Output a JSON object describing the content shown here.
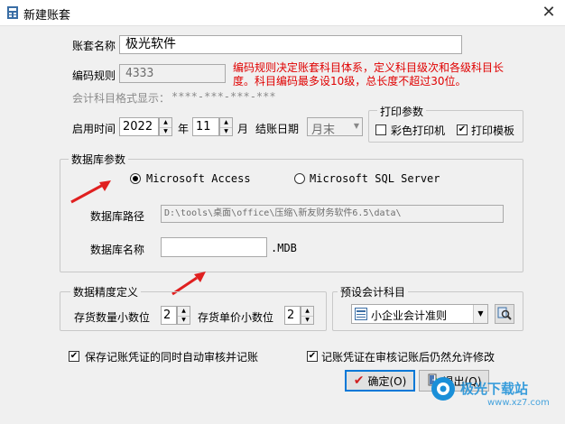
{
  "window": {
    "title": "新建账套",
    "close_glyph": "✕"
  },
  "account_name": {
    "label": "账套名称",
    "value": "极光软件"
  },
  "coding_rule": {
    "label": "编码规则",
    "value": "4333",
    "note": "编码规则决定账套科目体系，定义科目级次和各级科目长度。科目编码最多设10级，总长度不超过30位。",
    "format_label": "会计科目格式显示：",
    "format_value": "****-***-***-***"
  },
  "start_time": {
    "label": "启用时间",
    "year": "2022",
    "year_unit": "年",
    "month": "11",
    "month_unit": "月",
    "closing_label": "结账日期",
    "closing_value": "月末"
  },
  "print_params": {
    "title": "打印参数",
    "color_printer": {
      "label": "彩色打印机",
      "checked": false
    },
    "print_template": {
      "label": "打印模板",
      "checked": true
    }
  },
  "database": {
    "title": "数据库参数",
    "access_label": "Microsoft Access",
    "sql_label": "Microsoft SQL Server",
    "selected": "access",
    "path_label": "数据库路径",
    "path_value": "D:\\tools\\桌面\\office\\压缩\\新友财务软件6.5\\data\\",
    "name_label": "数据库名称",
    "name_value": "",
    "ext": ".MDB"
  },
  "precision": {
    "title": "数据精度定义",
    "qty_label": "存货数量小数位",
    "qty_value": "2",
    "price_label": "存货单价小数位",
    "price_value": "2"
  },
  "preset_subjects": {
    "title": "预设会计科目",
    "value": "小企业会计准则"
  },
  "options": {
    "auto_audit": {
      "label": "保存记账凭证的同时自动审核并记账",
      "checked": true
    },
    "allow_modify": {
      "label": "记账凭证在审核记账后仍然允许修改",
      "checked": true
    }
  },
  "buttons": {
    "ok": "确定(O)",
    "exit": "退出(Q)"
  },
  "watermark": {
    "brand": "极光下载站",
    "url": "www.xz7.com"
  },
  "colors": {
    "accent": "#0078d7",
    "note_red": "#e00000",
    "arrow_red": "#e02020"
  }
}
